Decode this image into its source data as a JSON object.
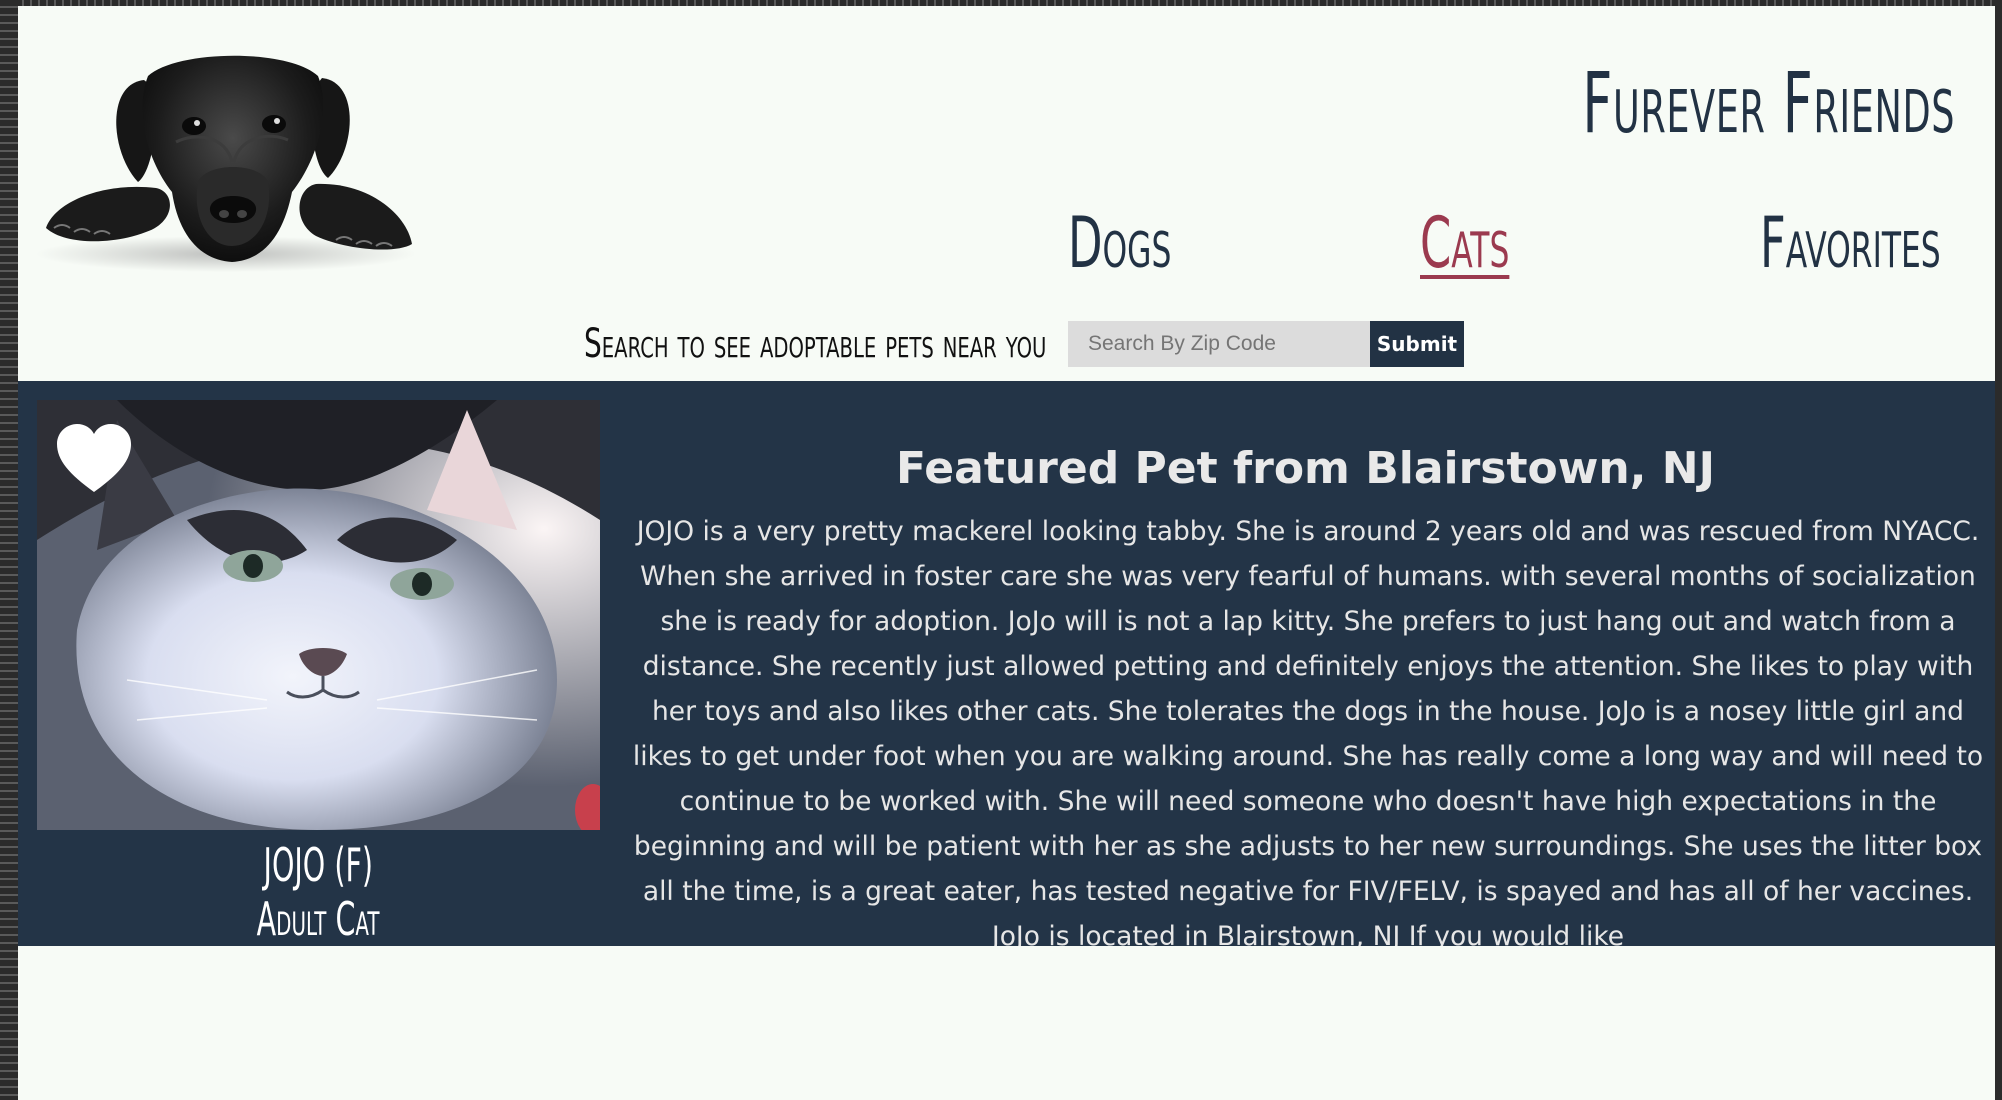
{
  "site": {
    "title": "Furever Friends"
  },
  "nav": {
    "items": [
      {
        "label": "Dogs",
        "active": false
      },
      {
        "label": "Cats",
        "active": true
      },
      {
        "label": "Favorites",
        "active": false
      }
    ]
  },
  "search": {
    "label": "Search to see adoptable pets near you",
    "placeholder": "Search By Zip Code",
    "value": "",
    "submit_label": "Submit"
  },
  "featured": {
    "title": "Featured Pet from Blairstown, NJ",
    "description": "JOJO is a very pretty mackerel looking tabby. She is around 2 years old and was rescued from NYACC. When she arrived in foster care she was very fearful of humans. with several months of socialization she is ready for adoption. JoJo will is not a lap kitty. She prefers to just hang out and watch from a distance. She recently just allowed petting and definitely enjoys the attention. She likes to play with her toys and also likes other cats. She tolerates the dogs in the house. JoJo is a nosey little girl and likes to get under foot when you are walking around. She has really come a long way and will need to continue to be worked with. She will need someone who doesn't have high expectations in the beginning and will be patient with her as she adjusts to her new surroundings. She uses the litter box all the time, is a great eater, has tested negative for FIV/FELV, is spayed and has all of her vaccines. JoJo is located in Blairstown, NJ If you would like",
    "pet": {
      "name": "JOJO (F)",
      "age_type": "Adult Cat",
      "favorite_icon": "heart-icon"
    }
  },
  "colors": {
    "navy": "#223244",
    "active_link": "#9b3a4f",
    "page_bg": "#f7fbf6",
    "featured_bg": "#233447"
  }
}
